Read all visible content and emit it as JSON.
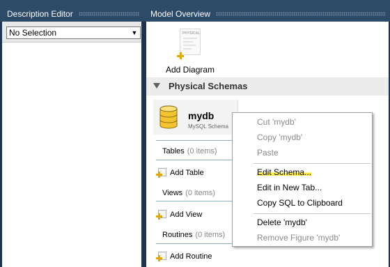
{
  "description_editor": {
    "title": "Description Editor",
    "selector": {
      "value": "No Selection"
    }
  },
  "model_overview": {
    "title": "Model Overview",
    "add_diagram": {
      "label": "Add Diagram",
      "thumbnail_tag": "PHYSICAL"
    },
    "physical_schemas": {
      "title": "Physical Schemas",
      "schema": {
        "name": "mydb",
        "subtitle": "MySQL Schema"
      },
      "sections": [
        {
          "label": "Tables",
          "count": "(0 items)",
          "add_label": "Add Table"
        },
        {
          "label": "Views",
          "count": "(0 items)",
          "add_label": "Add View"
        },
        {
          "label": "Routines",
          "count": "(0 items)",
          "add_label": "Add Routine"
        }
      ]
    }
  },
  "context_menu": {
    "items": [
      {
        "label": "Cut 'mydb'",
        "enabled": false
      },
      {
        "label": "Copy 'mydb'",
        "enabled": false
      },
      {
        "label": "Paste",
        "enabled": false
      },
      {
        "label": "Edit Schema...",
        "enabled": true,
        "highlighted_text": "Edit Schema"
      },
      {
        "label": "Edit in New Tab...",
        "enabled": true
      },
      {
        "label": "Copy SQL to Clipboard",
        "enabled": true
      },
      {
        "label": "Delete 'mydb'",
        "enabled": true
      },
      {
        "label": "Remove Figure 'mydb'",
        "enabled": false
      }
    ]
  },
  "colors": {
    "panel_header": "#2d4a69",
    "background": "#1b3550",
    "highlight": "#ffef3a",
    "add_icon": "#e0a800"
  }
}
